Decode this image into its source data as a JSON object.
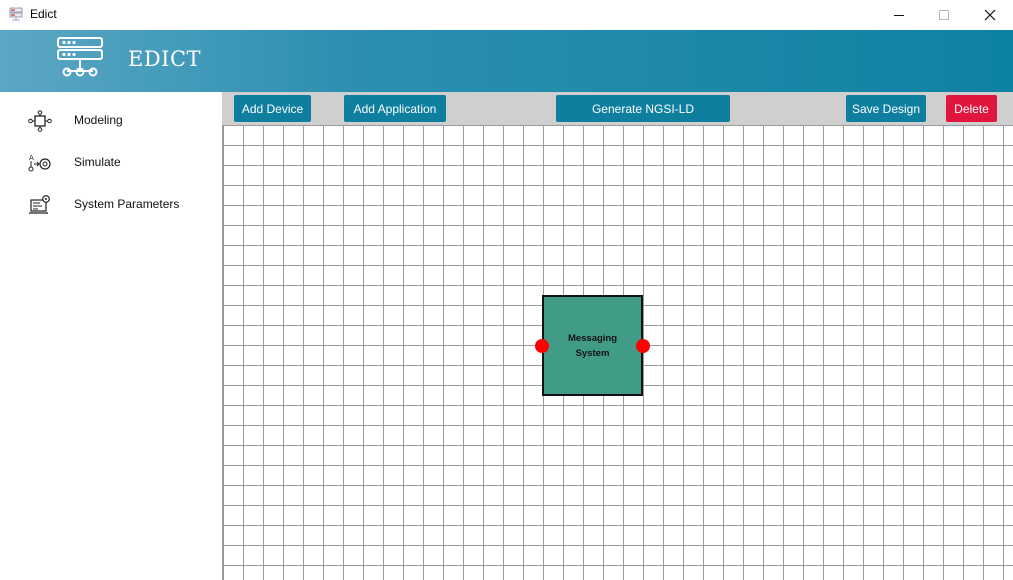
{
  "window": {
    "title": "Edict",
    "controls": {
      "minimize": "minimize-icon",
      "maximize": "maximize-icon",
      "close": "close-icon"
    }
  },
  "header": {
    "app_name": "EDICT",
    "logo_icon": "server-network-icon",
    "gradient": [
      "#5ba7c4",
      "#0e82a3"
    ]
  },
  "sidebar": {
    "items": [
      {
        "label": "Modeling",
        "icon": "modeling-icon"
      },
      {
        "label": "Simulate",
        "icon": "simulate-icon"
      },
      {
        "label": "System Parameters",
        "icon": "system-parameters-icon"
      }
    ]
  },
  "toolbar": {
    "add_device": "Add Device",
    "add_application": "Add Application",
    "generate": "Generate NGSI-LD",
    "save_design": "Save Design",
    "delete": "Delete",
    "button_color": "#0f7f9f",
    "delete_color": "#e0163f"
  },
  "canvas": {
    "nodes": [
      {
        "label": "Messaging System",
        "color": "#419c87",
        "port_color": "#ff0000"
      }
    ]
  }
}
